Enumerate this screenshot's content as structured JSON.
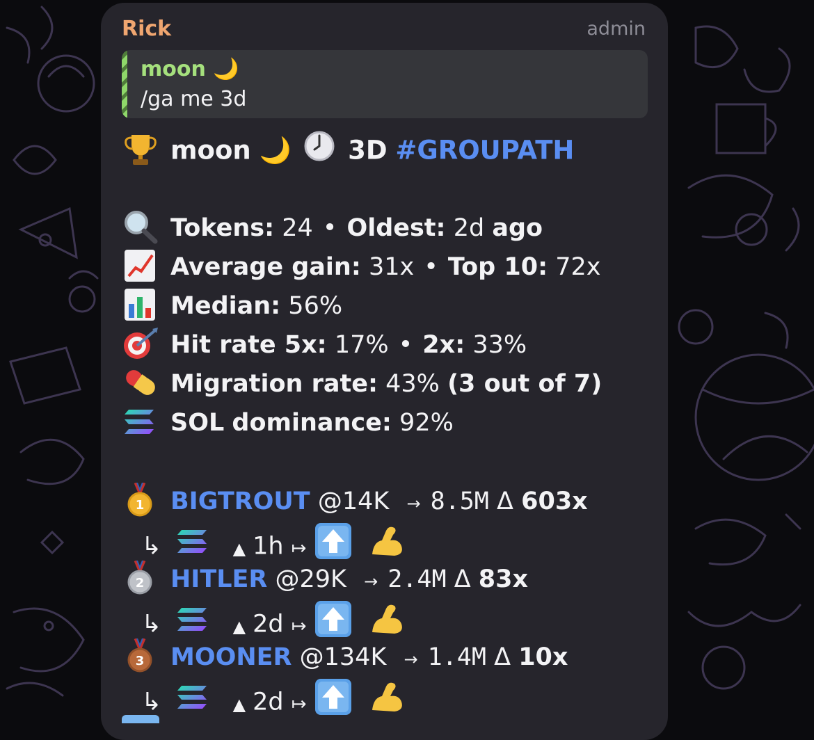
{
  "message": {
    "sender": "Rick",
    "role": "admin",
    "reply": {
      "author": "moon",
      "author_emoji": "🌙",
      "text": "/ga me 3d"
    },
    "title": {
      "name": "moon",
      "moon_emoji": "🌙",
      "period": "3D",
      "hashtag": "#GROUPATH"
    },
    "stats": {
      "tokens_label": "Tokens:",
      "tokens_value": "24",
      "separator": "•",
      "oldest_label": "Oldest:",
      "oldest_value": "2d",
      "oldest_suffix": "ago",
      "avg_label": "Average gain:",
      "avg_value": "31x",
      "top10_label": "Top 10:",
      "top10_value": "72x",
      "median_label": "Median:",
      "median_value": "56%",
      "hit5_label": "Hit rate 5x:",
      "hit5_value": "17%",
      "hit2_label": "2x:",
      "hit2_value": "33%",
      "migration_label": "Migration rate:",
      "migration_value": "43%",
      "migration_detail": "(3 out of 7)",
      "sol_label": "SOL",
      "dominance_label": "dominance:",
      "sol_value": "92%"
    },
    "leaders": [
      {
        "rank": "1",
        "name": "BIGTROUT",
        "at": "@",
        "entry": "14K",
        "arrow": "→",
        "peak": "8.5M",
        "delta": "Δ",
        "multiple": "603x",
        "hook": "↳",
        "up": "▲",
        "age": "1h",
        "mapsto": "↦",
        "up_emoji": "⬆️",
        "muscle": "💪"
      },
      {
        "rank": "2",
        "name": "HITLER",
        "at": "@",
        "entry": "29K",
        "arrow": "→",
        "peak": "2.4M",
        "delta": "Δ",
        "multiple": "83x",
        "hook": "↳",
        "up": "▲",
        "age": "2d",
        "mapsto": "↦",
        "up_emoji": "⬆️",
        "muscle": "💪"
      },
      {
        "rank": "3",
        "name": "MOONER",
        "at": "@",
        "entry": "134K",
        "arrow": "→",
        "peak": "1.4M",
        "delta": "Δ",
        "multiple": "10x",
        "hook": "↳",
        "up": "▲",
        "age": "2d",
        "mapsto": "↦",
        "up_emoji": "⬆️",
        "muscle": "💪"
      }
    ]
  },
  "icons": [
    "trophy-icon",
    "clock-icon",
    "magnifier-icon",
    "chart-up-icon",
    "bar-chart-icon",
    "target-icon",
    "pill-icon",
    "solana-icon",
    "gold-medal-icon",
    "silver-medal-icon",
    "bronze-medal-icon",
    "up-arrow-icon",
    "muscle-icon"
  ]
}
